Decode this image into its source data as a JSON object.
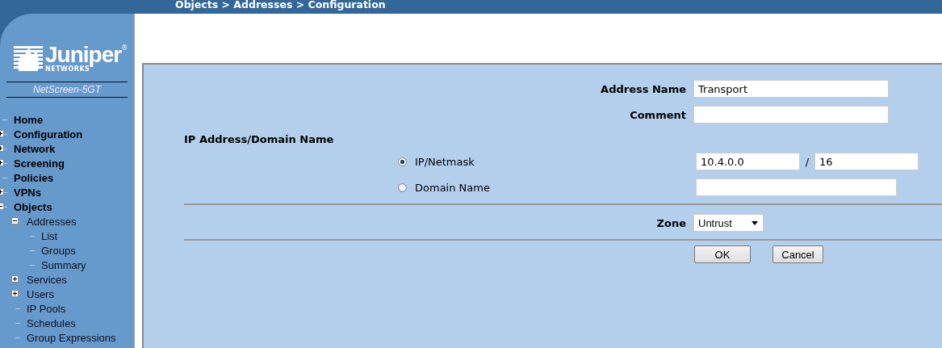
{
  "breadcrumb": "Objects > Addresses > Configuration",
  "logo": {
    "wordmark": "Juniper",
    "registered": "®",
    "subtitle": "NETWORKS"
  },
  "device": "NetScreen-5GT",
  "nav": [
    {
      "label": "Home"
    },
    {
      "label": "Configuration",
      "expanded": false
    },
    {
      "label": "Network",
      "expanded": false
    },
    {
      "label": "Screening",
      "expanded": false
    },
    {
      "label": "Policies"
    },
    {
      "label": "VPNs",
      "expanded": false
    },
    {
      "label": "Objects",
      "expanded": true,
      "children": [
        {
          "label": "Addresses",
          "expanded": true,
          "children": [
            {
              "label": "List"
            },
            {
              "label": "Groups"
            },
            {
              "label": "Summary"
            }
          ]
        },
        {
          "label": "Services",
          "expanded": false
        },
        {
          "label": "Users",
          "expanded": false
        },
        {
          "label": "IP Pools"
        },
        {
          "label": "Schedules"
        },
        {
          "label": "Group Expressions"
        }
      ]
    }
  ],
  "form": {
    "address_name": {
      "label": "Address Name",
      "value": "Transport"
    },
    "comment": {
      "label": "Comment"
    },
    "section": "IP Address/Domain Name",
    "options": [
      {
        "label": "IP/Netmask",
        "selected": true,
        "kind": "netmask",
        "ip": "10.4.0.0",
        "separator": "/",
        "mask": "16"
      },
      {
        "label": "Domain Name",
        "selected": false,
        "kind": "domain"
      }
    ],
    "zone": {
      "label": "Zone",
      "value": "Untrust"
    },
    "buttons": [
      "OK",
      "Cancel"
    ]
  }
}
